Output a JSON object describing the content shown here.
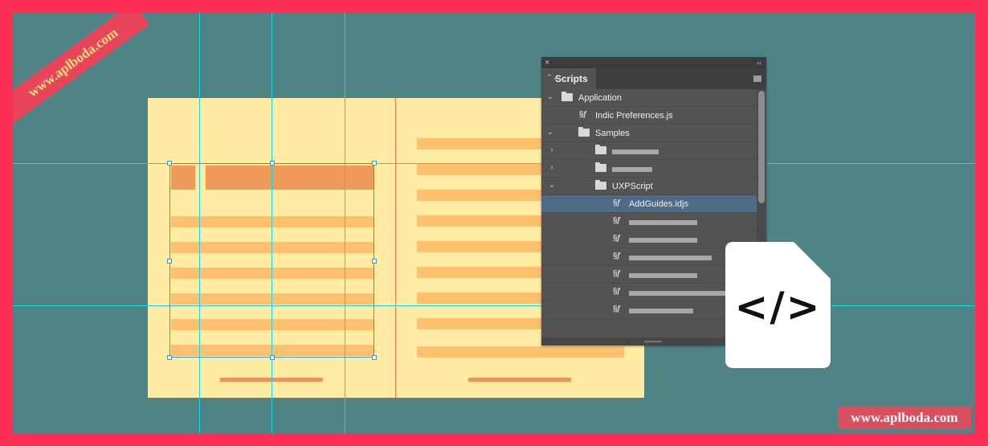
{
  "panel": {
    "close_icon": "×",
    "collapse_icon": "‹‹",
    "tab_title": "Scripts",
    "tab_icon": "⌃⌄"
  },
  "tree": [
    {
      "label": "Application",
      "kind": "folder",
      "expanded": true,
      "depth": 0
    },
    {
      "label": "Indic Preferences.js",
      "kind": "script",
      "depth": 1
    },
    {
      "label": "Samples",
      "kind": "folder",
      "expanded": true,
      "depth": 1
    },
    {
      "label": "",
      "kind": "folder",
      "expanded": false,
      "depth": 2,
      "obscured": true
    },
    {
      "label": "",
      "kind": "folder",
      "expanded": false,
      "depth": 2,
      "obscured": true
    },
    {
      "label": "UXPScript",
      "kind": "folder",
      "expanded": true,
      "depth": 2
    },
    {
      "label": "AddGuides.idjs",
      "kind": "script",
      "depth": 3,
      "selected": true
    },
    {
      "label": "",
      "kind": "script",
      "depth": 3,
      "obscured": true
    },
    {
      "label": "",
      "kind": "script",
      "depth": 3,
      "obscured": true
    },
    {
      "label": "",
      "kind": "script",
      "depth": 3,
      "obscured": true
    },
    {
      "label": "",
      "kind": "script",
      "depth": 3,
      "obscured": true
    },
    {
      "label": "",
      "kind": "script",
      "depth": 3,
      "obscured": true
    },
    {
      "label": "",
      "kind": "script",
      "depth": 3,
      "obscured": true
    }
  ],
  "code_icon": {
    "glyph": "</>"
  },
  "watermarks": {
    "ribbon": "www.aplboda.com",
    "bottom": "www.aplboda.com"
  },
  "colors": {
    "frame": "#ff2d55",
    "canvas": "#4f8487",
    "page": "#ffeca2",
    "text_bar": "#ffc06d",
    "heading_bar": "#f09a5a",
    "guide": "#19d4e6",
    "selection_row": "#4e6c88"
  }
}
